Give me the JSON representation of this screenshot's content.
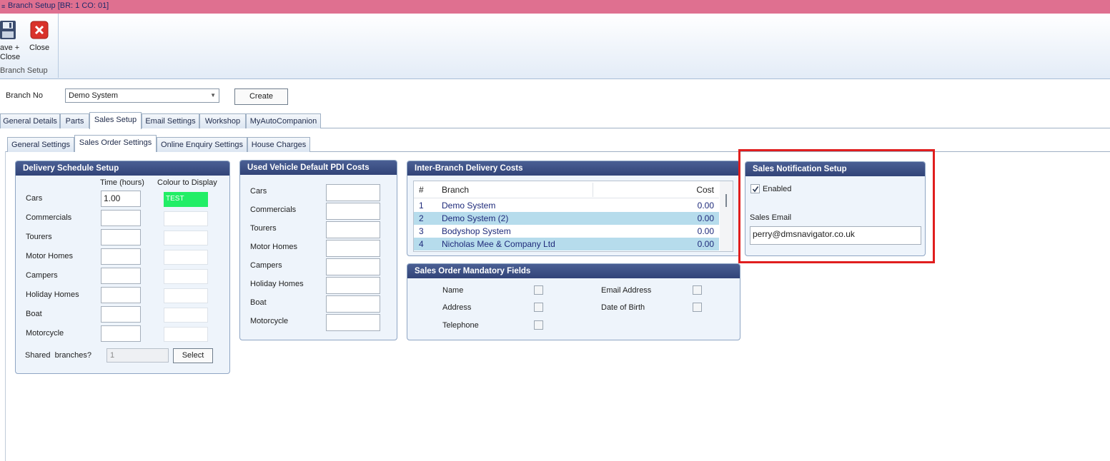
{
  "window": {
    "title": "Branch Setup [BR: 1 CO: 01]"
  },
  "ribbon": {
    "save_close_line1": "ave +",
    "save_close_line2": "Close",
    "close_label": "Close",
    "group_label": "Branch Setup"
  },
  "branch": {
    "label": "Branch No",
    "selected": "Demo System",
    "create_label": "Create"
  },
  "tabs": [
    "General Details",
    "Parts",
    "Sales Setup",
    "Email Settings",
    "Workshop",
    "MyAutoCompanion"
  ],
  "subtabs": [
    "General Settings",
    "Sales Order Settings",
    "Online Enquiry Settings",
    "House Charges"
  ],
  "delivery": {
    "title": "Delivery Schedule Setup",
    "col_time": "Time (hours)",
    "col_colour": "Colour to Display",
    "rows": [
      "Cars",
      "Commercials",
      "Tourers",
      "Motor Homes",
      "Campers",
      "Holiday Homes",
      "Boat",
      "Motorcycle"
    ],
    "cars_time": "1.00",
    "cars_colour_text": "TEST",
    "cars_colour": "#22ee66",
    "shared_label": "Shared  branches?",
    "shared_value": "1",
    "select_label": "Select"
  },
  "pdi": {
    "title": "Used Vehicle Default PDI Costs",
    "rows": [
      "Cars",
      "Commercials",
      "Tourers",
      "Motor Homes",
      "Campers",
      "Holiday Homes",
      "Boat",
      "Motorcycle"
    ]
  },
  "interbranch": {
    "title": "Inter-Branch Delivery Costs",
    "headers": {
      "num": "#",
      "branch": "Branch",
      "cost": "Cost"
    },
    "rows": [
      {
        "num": "1",
        "branch": "Demo System",
        "cost": "0.00"
      },
      {
        "num": "2",
        "branch": "Demo System (2)",
        "cost": "0.00"
      },
      {
        "num": "3",
        "branch": "Bodyshop System",
        "cost": "0.00"
      },
      {
        "num": "4",
        "branch": "Nicholas Mee & Company Ltd",
        "cost": "0.00"
      }
    ]
  },
  "mandatory": {
    "title": "Sales Order Mandatory Fields",
    "name": "Name",
    "address": "Address",
    "telephone": "Telephone",
    "email": "Email Address",
    "dob": "Date of Birth"
  },
  "notification": {
    "title": "Sales Notification Setup",
    "enabled_label": "Enabled",
    "email_label": "Sales Email",
    "email_value": "perry@dmsnavigator.co.uk"
  },
  "colors": {
    "title_bar": "#df7090",
    "panel_header": "#3a4c82",
    "highlight": "#e01e1e",
    "selected_row": "#b6dcec"
  }
}
